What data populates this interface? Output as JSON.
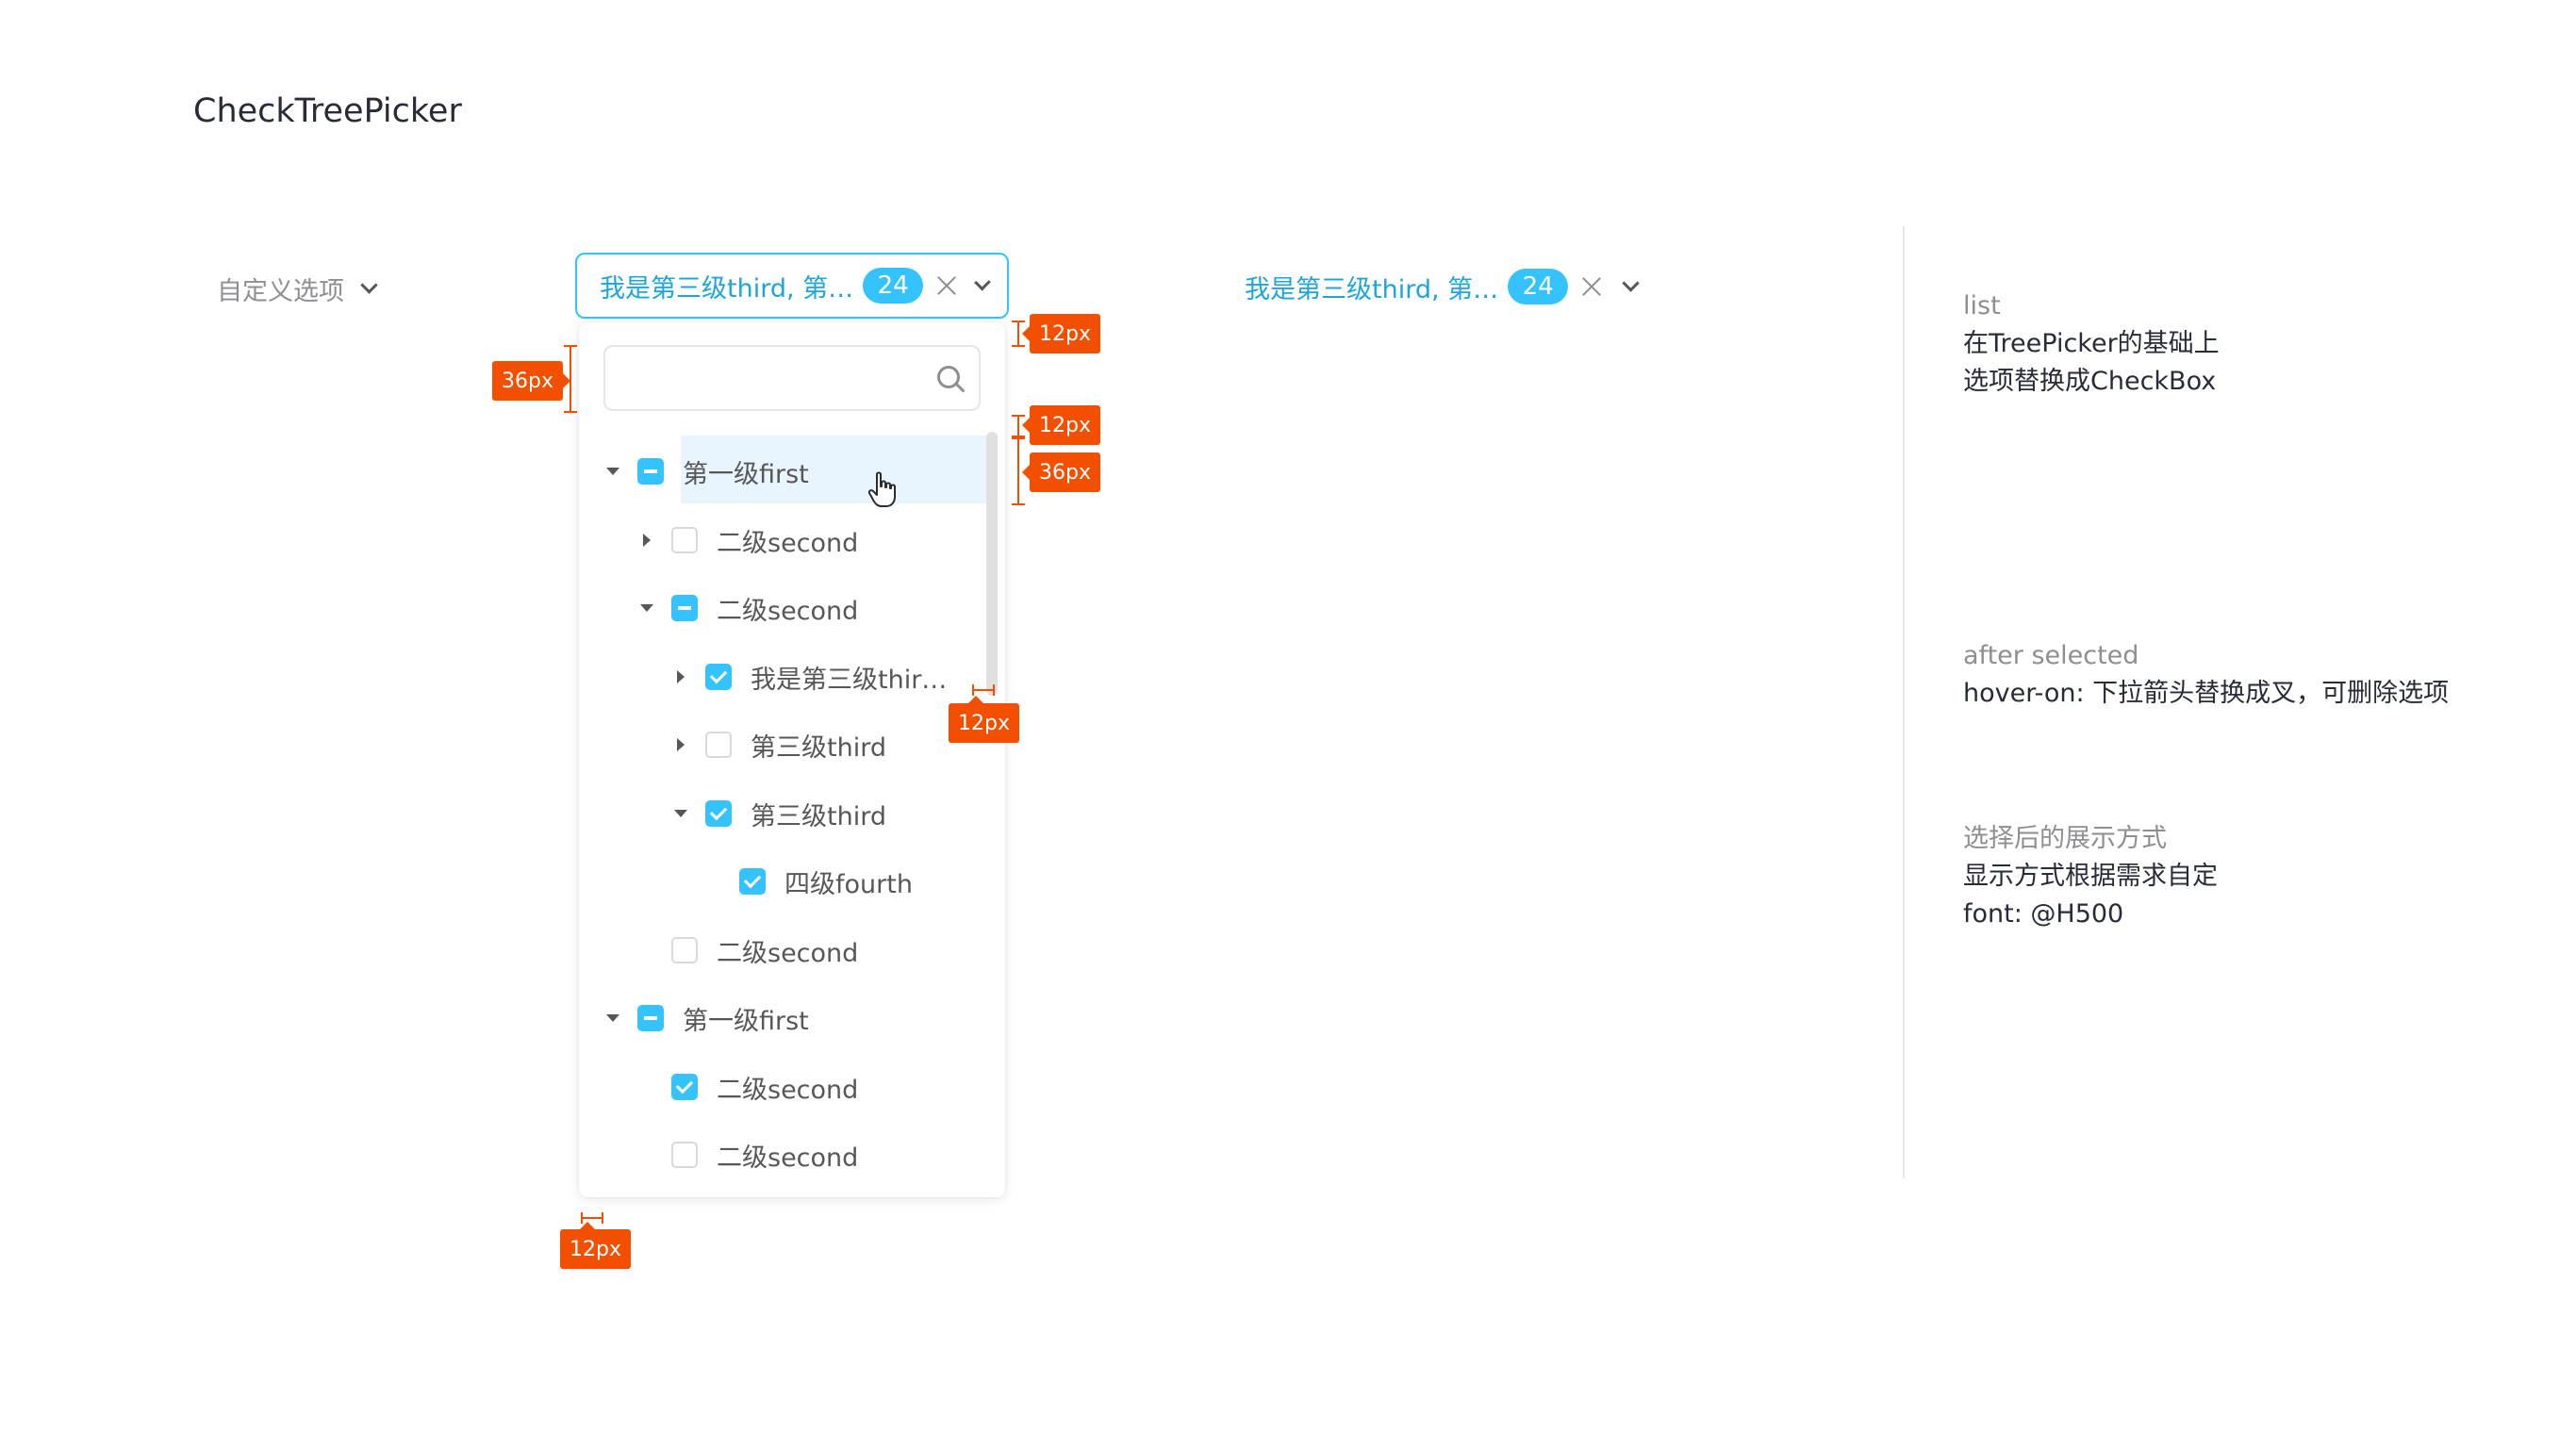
{
  "page_title": "CheckTreePicker",
  "custom_trigger_label": "自定义选项",
  "picker": {
    "value_text": "我是第三级third, 第…",
    "count_badge": "24"
  },
  "tree_items": [
    {
      "label": "第一级first",
      "level": 1,
      "expand": "expanded",
      "check": "indeterminate",
      "hover": true
    },
    {
      "label": "二级second",
      "level": 2,
      "expand": "collapsed",
      "check": "unchecked"
    },
    {
      "label": "二级second",
      "level": 2,
      "expand": "expanded",
      "check": "indeterminate"
    },
    {
      "label": "我是第三级thir…",
      "level": 3,
      "expand": "collapsed",
      "check": "checked"
    },
    {
      "label": "第三级third",
      "level": 3,
      "expand": "collapsed",
      "check": "unchecked"
    },
    {
      "label": "第三级third",
      "level": 3,
      "expand": "expanded",
      "check": "checked"
    },
    {
      "label": "四级fourth",
      "level": 4,
      "expand": "none",
      "check": "checked"
    },
    {
      "label": "二级second",
      "level": 2,
      "expand": "none",
      "check": "unchecked"
    },
    {
      "label": "第一级first",
      "level": 1,
      "expand": "expanded",
      "check": "indeterminate"
    },
    {
      "label": "二级second",
      "level": 2,
      "expand": "none",
      "check": "checked"
    },
    {
      "label": "二级second",
      "level": 2,
      "expand": "none",
      "check": "unchecked"
    }
  ],
  "annotations": {
    "padding_12": "12px",
    "height_36": "36px"
  },
  "notes": [
    {
      "heading": "list",
      "lines": [
        "在TreePicker的基础上",
        "选项替换成CheckBox"
      ]
    },
    {
      "heading": "after selected",
      "lines": [
        "hover-on: 下拉箭头替换成叉，可删除选项"
      ]
    },
    {
      "heading": "选择后的展示方式",
      "lines": [
        "显示方式根据需求自定",
        "font: @H500"
      ]
    }
  ],
  "colors": {
    "primary": "#34c3ff",
    "primary_text": "#1ea5dd",
    "hover_row": "#e9f5fe",
    "annotation": "#f25000",
    "text": "#272c36",
    "muted": "#8e8e93"
  },
  "icons": [
    "chevron-down-icon",
    "search-icon",
    "close-icon",
    "caret-down-icon",
    "caret-right-icon",
    "hand-cursor-icon"
  ]
}
